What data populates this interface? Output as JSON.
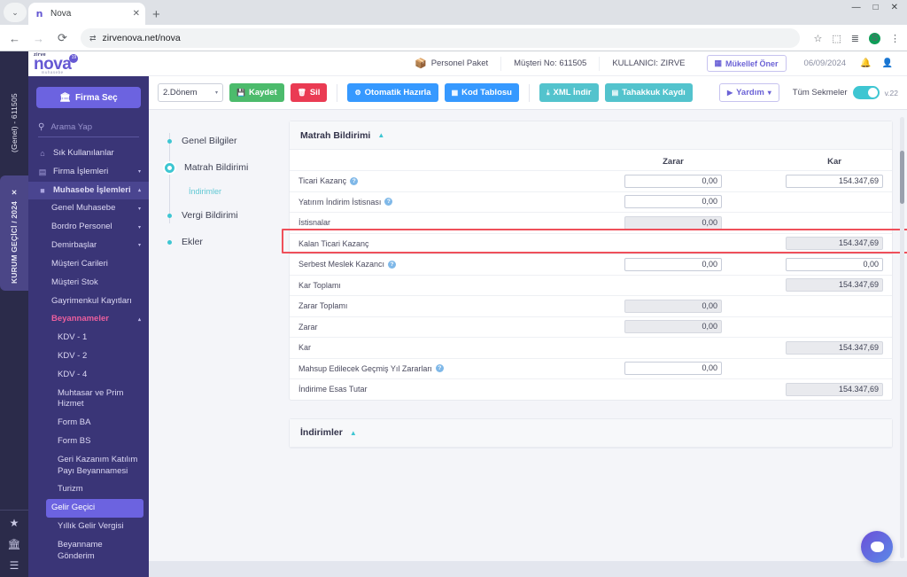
{
  "browser": {
    "tab": {
      "title": "Nova",
      "favicon_glyph": "n",
      "close_label": "✕"
    },
    "new_tab_label": "+",
    "menu_chip_glyph": "⌄",
    "window_controls": {
      "minimize": "—",
      "maximize": "□",
      "close": "✕"
    },
    "nav": {
      "back": "←",
      "forward": "→",
      "reload": "⟳"
    },
    "omnibox": {
      "url": "zirvenova.net/nova",
      "site_icon": "⇄"
    },
    "toolbar_icons": {
      "bookmark": "☆",
      "extensions": "⬚",
      "tab_list": "≣",
      "profile_initial": "S",
      "menu": "⋮"
    }
  },
  "rail": {
    "tabs": [
      {
        "label": "(Genel) - 611505",
        "active": false
      },
      {
        "label": "KURUM GEÇİCİ / 2024",
        "active": true,
        "close": "✕"
      }
    ],
    "bottom_icons": [
      "★",
      "Ἵb",
      "☰"
    ]
  },
  "logo": {
    "sup": "zirve",
    "main": "nova",
    "sub": "muhasebe",
    "badge": "19"
  },
  "sidebar": {
    "firma_button": {
      "label": "Firma Seç",
      "icon": "Ἵb"
    },
    "search": {
      "placeholder": "Arama Yap",
      "value": "",
      "icon": "search-icon"
    },
    "items": [
      {
        "label": "Sık Kullanılanlar",
        "icon": "⌂",
        "caret": ""
      },
      {
        "label": "Firma İşlemleri",
        "icon": "▤",
        "caret": "▾"
      },
      {
        "label": "Muhasebe İşlemleri",
        "icon": "■",
        "caret": "▴",
        "open": true
      }
    ],
    "sub_items": [
      {
        "label": "Genel Muhasebe",
        "caret": "▾"
      },
      {
        "label": "Bordro Personel",
        "caret": "▾"
      },
      {
        "label": "Demirbaşlar",
        "caret": "▾"
      },
      {
        "label": "Müşteri Carileri",
        "caret": ""
      },
      {
        "label": "Müşteri Stok",
        "caret": ""
      },
      {
        "label": "Gayrimenkul Kayıtları",
        "caret": ""
      },
      {
        "label": "Beyannameler",
        "caret": "▴",
        "group": true
      }
    ],
    "beyanname_items": [
      {
        "label": "KDV - 1"
      },
      {
        "label": "KDV - 2"
      },
      {
        "label": "KDV - 4"
      },
      {
        "label": "Muhtasar ve Prim Hizmet"
      },
      {
        "label": "Form BA"
      },
      {
        "label": "Form BS"
      },
      {
        "label": "Geri Kazanım Katılım Payı Beyannamesi"
      },
      {
        "label": "Turizm"
      },
      {
        "label": "Gelir Geçici",
        "selected": true
      },
      {
        "label": "Yıllık Gelir Vergisi"
      },
      {
        "label": "Beyanname Gönderim"
      }
    ]
  },
  "app_header": {
    "package": "Personel Paket",
    "customer": "Müşteri No: 611505",
    "user": "KULLANICI: ZIRVE",
    "mukellef_button": "Mükellef Öner",
    "date": "06/09/2024",
    "bell_icon": "ὑ4",
    "user_icon": "὆4"
  },
  "page_tab": {
    "label": "Gelir Geçici",
    "close": "✖"
  },
  "toolbar": {
    "period": {
      "value": "2.Dönem",
      "caret": "▾"
    },
    "save": {
      "label": "Kaydet",
      "icon": "Ὃe"
    },
    "delete": {
      "label": "Sil",
      "icon": "Ὕ1"
    },
    "auto_prepare": {
      "label": "Otomatik Hazırla",
      "icon": "⚙"
    },
    "code_table": {
      "label": "Kod Tablosu",
      "icon": "▦"
    },
    "xml_download": {
      "label": "XML İndir",
      "icon": "⤓"
    },
    "accrual_record": {
      "label": "Tahakkuk Kaydı",
      "icon": "▤"
    },
    "help": {
      "label": "Yardım",
      "icon": "▶",
      "caret": "▾"
    },
    "all_tabs_label": "Tüm Sekmeler",
    "all_tabs_on": true,
    "version": "v.22"
  },
  "steps": [
    {
      "label": "Genel Bilgiler",
      "active": false,
      "sub": false
    },
    {
      "label": "Matrah Bildirimi",
      "active": true,
      "sub": false
    },
    {
      "label": "İndirimler",
      "active": false,
      "sub": true
    },
    {
      "label": "Vergi Bildirimi",
      "active": false,
      "sub": false
    },
    {
      "label": "Ekler",
      "active": false,
      "sub": false
    }
  ],
  "matrah_card": {
    "title": "Matrah Bildirimi",
    "collapse_icon": "▲",
    "columns": [
      "Zarar",
      "Kar"
    ],
    "rows": [
      {
        "label": "Ticari Kazanç",
        "help": true,
        "zarar": "0,00",
        "zarar_ro": false,
        "kar": "154.347,69",
        "kar_ro": false,
        "highlight": true
      },
      {
        "label": "Yatırım İndirim İstisnası",
        "help": true,
        "zarar": "0,00",
        "zarar_ro": false,
        "kar": null,
        "kar_ro": false
      },
      {
        "label": "İstisnalar",
        "help": false,
        "zarar": "0,00",
        "zarar_ro": true,
        "kar": null,
        "kar_ro": false
      },
      {
        "label": "Kalan Ticari Kazanç",
        "help": false,
        "zarar": null,
        "zarar_ro": false,
        "kar": "154.347,69",
        "kar_ro": true
      },
      {
        "label": "Serbest Meslek Kazancı",
        "help": true,
        "zarar": "0,00",
        "zarar_ro": false,
        "kar": "0,00",
        "kar_ro": false
      },
      {
        "label": "Kar Toplamı",
        "help": false,
        "zarar": null,
        "zarar_ro": false,
        "kar": "154.347,69",
        "kar_ro": true
      },
      {
        "label": "Zarar Toplamı",
        "help": false,
        "zarar": "0,00",
        "zarar_ro": true,
        "kar": null,
        "kar_ro": false
      },
      {
        "label": "Zarar",
        "help": false,
        "zarar": "0,00",
        "zarar_ro": true,
        "kar": null,
        "kar_ro": false
      },
      {
        "label": "Kar",
        "help": false,
        "zarar": null,
        "zarar_ro": false,
        "kar": "154.347,69",
        "kar_ro": true
      },
      {
        "label": "Mahsup Edilecek Geçmiş Yıl Zararları",
        "help": true,
        "zarar": "0,00",
        "zarar_ro": false,
        "kar": null,
        "kar_ro": false
      },
      {
        "label": "İndirime Esas Tutar",
        "help": false,
        "zarar": null,
        "zarar_ro": false,
        "kar": "154.347,69",
        "kar_ro": true
      }
    ]
  },
  "indirimler_card": {
    "title": "İndirimler",
    "collapse_icon": "▲"
  },
  "colors": {
    "brand_purple": "#6558d3",
    "sidebar": "#3a3577",
    "rail": "#2b2b4a",
    "accent_teal": "#3ec6d2",
    "green": "#4cbb6c",
    "red": "#ea3b53",
    "blue": "#3699ff",
    "highlight_red": "#ef4f5a",
    "pink": "#ec5f9e"
  },
  "chat": {
    "icon": "chat-bubble-icon"
  }
}
